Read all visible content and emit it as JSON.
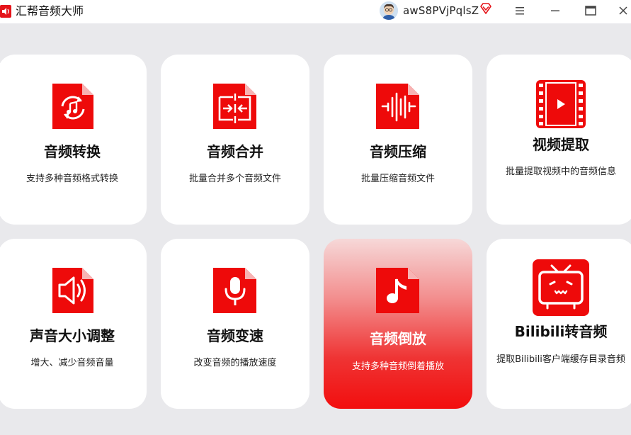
{
  "app": {
    "title": "汇帮音频大师",
    "username": "awS8PVjPqlsZ"
  },
  "colors": {
    "accent": "#f21616",
    "background": "#e9e9ec",
    "card": "#ffffff"
  },
  "cards": [
    {
      "title": "音频转换",
      "desc": "支持多种音频格式转换",
      "icon": "music-convert-icon"
    },
    {
      "title": "音频合并",
      "desc": "批量合并多个音频文件",
      "icon": "merge-icon"
    },
    {
      "title": "音频压缩",
      "desc": "批量压缩音频文件",
      "icon": "waveform-compress-icon"
    },
    {
      "title": "视频提取",
      "desc": "批量提取视频中的音频信息",
      "icon": "video-film-icon"
    },
    {
      "title": "声音大小调整",
      "desc": "增大、减少音频音量",
      "icon": "speaker-volume-icon"
    },
    {
      "title": "音频变速",
      "desc": "改变音频的播放速度",
      "icon": "microphone-icon"
    },
    {
      "title": "音频倒放",
      "desc": "支持多种音频倒着播放",
      "icon": "music-note-icon",
      "active": true
    },
    {
      "title": "Bilibili转音频",
      "desc": "提取Bilibili客户端缓存目录音频",
      "icon": "bilibili-tv-icon"
    }
  ]
}
